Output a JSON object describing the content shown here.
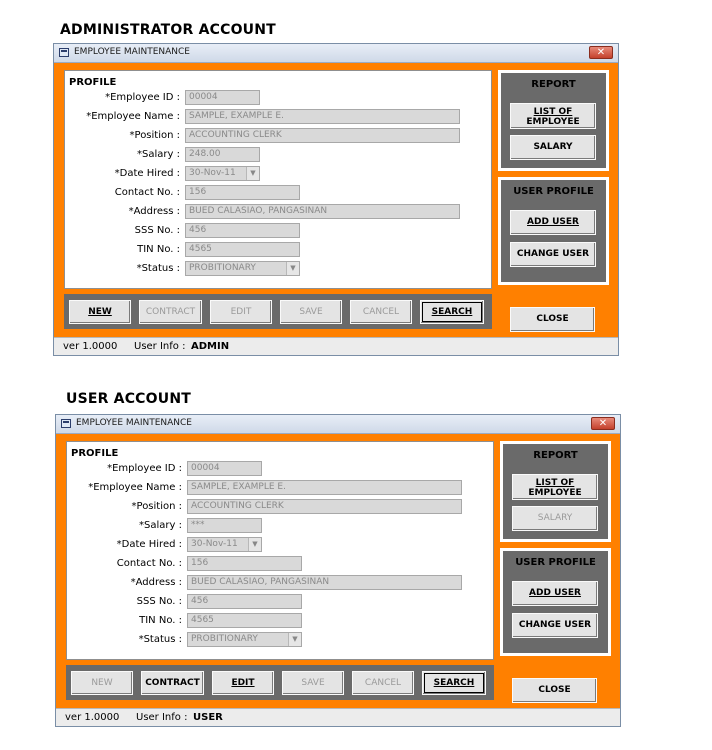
{
  "sections": [
    {
      "heading": "ADMINISTRATOR ACCOUNT",
      "window": {
        "title": "EMPLOYEE MAINTENANCE",
        "close_glyph": "✕",
        "profile": {
          "title": "PROFILE",
          "fields": {
            "employee_id": {
              "label": "*Employee ID :",
              "value": "00004"
            },
            "employee_name": {
              "label": "*Employee Name :",
              "value": "SAMPLE, EXAMPLE E."
            },
            "position": {
              "label": "*Position :",
              "value": "ACCOUNTING CLERK"
            },
            "salary": {
              "label": "*Salary :",
              "value": "248.00"
            },
            "date_hired": {
              "label": "*Date Hired :",
              "value": "30-Nov-11"
            },
            "contact_no": {
              "label": "Contact No. :",
              "value": "156"
            },
            "address": {
              "label": "*Address :",
              "value": "BUED CALASIAO, PANGASINAN"
            },
            "sss_no": {
              "label": "SSS No. :",
              "value": "456"
            },
            "tin_no": {
              "label": "TIN No. :",
              "value": "4565"
            },
            "status": {
              "label": "*Status :",
              "value": "PROBITIONARY"
            }
          }
        },
        "buttons": {
          "new": {
            "label": "NEW",
            "enabled": true
          },
          "contract": {
            "label": "CONTRACT",
            "enabled": false
          },
          "edit": {
            "label": "EDIT",
            "enabled": false
          },
          "save": {
            "label": "SAVE",
            "enabled": false
          },
          "cancel": {
            "label": "CANCEL",
            "enabled": false
          },
          "search": {
            "label": "SEARCH",
            "enabled": true
          }
        },
        "report": {
          "title": "REPORT",
          "list_line1": "LIST OF",
          "list_line2": "EMPLOYEE",
          "salary": "SALARY",
          "salary_enabled": true
        },
        "user_profile": {
          "title": "USER PROFILE",
          "add_user": "ADD USER",
          "change_user": "CHANGE USER"
        },
        "close_label": "CLOSE",
        "status": {
          "version": "ver 1.0000",
          "user_info_label": "User Info :",
          "user_info_value": "ADMIN"
        }
      }
    },
    {
      "heading": "USER ACCOUNT",
      "window": {
        "title": "EMPLOYEE MAINTENANCE",
        "close_glyph": "✕",
        "profile": {
          "title": "PROFILE",
          "fields": {
            "employee_id": {
              "label": "*Employee ID :",
              "value": "00004"
            },
            "employee_name": {
              "label": "*Employee Name :",
              "value": "SAMPLE, EXAMPLE E."
            },
            "position": {
              "label": "*Position :",
              "value": "ACCOUNTING CLERK"
            },
            "salary": {
              "label": "*Salary :",
              "value": "***"
            },
            "date_hired": {
              "label": "*Date Hired :",
              "value": "30-Nov-11"
            },
            "contact_no": {
              "label": "Contact No. :",
              "value": "156"
            },
            "address": {
              "label": "*Address :",
              "value": "BUED CALASIAO, PANGASINAN"
            },
            "sss_no": {
              "label": "SSS No. :",
              "value": "456"
            },
            "tin_no": {
              "label": "TIN No. :",
              "value": "4565"
            },
            "status": {
              "label": "*Status :",
              "value": "PROBITIONARY"
            }
          }
        },
        "buttons": {
          "new": {
            "label": "NEW",
            "enabled": false
          },
          "contract": {
            "label": "CONTRACT",
            "enabled": true
          },
          "edit": {
            "label": "EDIT",
            "enabled": true
          },
          "save": {
            "label": "SAVE",
            "enabled": false
          },
          "cancel": {
            "label": "CANCEL",
            "enabled": false
          },
          "search": {
            "label": "SEARCH",
            "enabled": true
          }
        },
        "report": {
          "title": "REPORT",
          "list_line1": "LIST OF",
          "list_line2": "EMPLOYEE",
          "salary": "SALARY",
          "salary_enabled": false
        },
        "user_profile": {
          "title": "USER PROFILE",
          "add_user": "ADD USER",
          "change_user": "CHANGE USER"
        },
        "close_label": "CLOSE",
        "status": {
          "version": "ver 1.0000",
          "user_info_label": "User Info :",
          "user_info_value": "USER"
        }
      }
    }
  ]
}
